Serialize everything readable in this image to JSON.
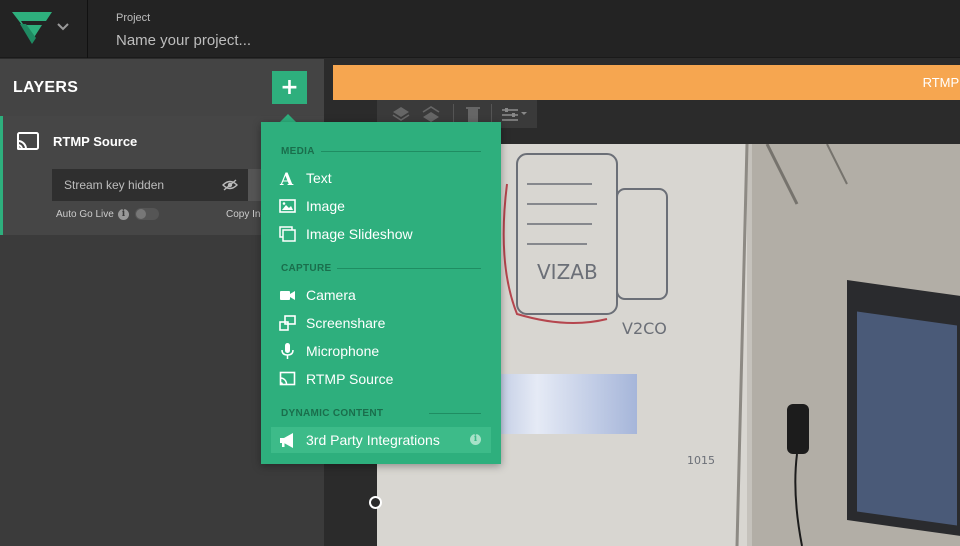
{
  "header": {
    "project_label": "Project",
    "project_placeholder": "Name your project..."
  },
  "sidebar": {
    "title": "LAYERS",
    "add_button_label": "+",
    "layer": {
      "name": "RTMP Source",
      "stream_key": "Stream key hidden",
      "auto_go_live_label": "Auto Go Live",
      "auto_go_live_info": "i",
      "copy_ingest_label": "Copy Ingest"
    }
  },
  "banner": {
    "text": "RTMP source is being"
  },
  "add_menu": {
    "sections": [
      {
        "title": "MEDIA",
        "items": [
          {
            "label": "Text",
            "icon": "text-icon"
          },
          {
            "label": "Image",
            "icon": "image-icon"
          },
          {
            "label": "Image Slideshow",
            "icon": "slideshow-icon"
          }
        ]
      },
      {
        "title": "CAPTURE",
        "items": [
          {
            "label": "Camera",
            "icon": "camera-icon"
          },
          {
            "label": "Screenshare",
            "icon": "screenshare-icon"
          },
          {
            "label": "Microphone",
            "icon": "microphone-icon"
          },
          {
            "label": "RTMP Source",
            "icon": "rtmp-icon"
          }
        ]
      },
      {
        "title": "DYNAMIC CONTENT",
        "items": [
          {
            "label": "3rd Party Integrations",
            "icon": "megaphone-icon",
            "info": "i"
          }
        ]
      }
    ]
  },
  "colors": {
    "accent": "#2eaf7d",
    "banner": "#f6a650",
    "topbar": "#232323",
    "sidebar": "#3b3b3b"
  }
}
